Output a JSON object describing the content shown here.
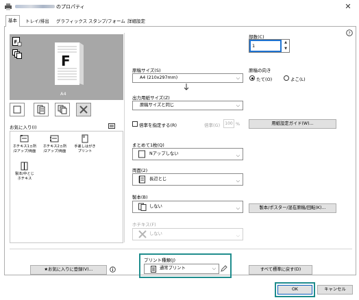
{
  "window": {
    "title": "のプロパティ",
    "close_icon": "close-icon"
  },
  "tabs": [
    {
      "label": "基本",
      "active": true
    },
    {
      "label": "トレイ/排出",
      "active": false
    },
    {
      "label": "グラフィックス",
      "active": false
    },
    {
      "label": "スタンプ/フォーム",
      "active": false
    },
    {
      "label": "詳細設定",
      "active": false
    }
  ],
  "help_icon": "?",
  "preview": {
    "paper_label": "A4",
    "view_buttons": [
      "single-page-view",
      "booklet-view",
      "copies-view",
      "tools-view"
    ]
  },
  "favorites": {
    "label": "お気に入り(I)",
    "items": [
      {
        "label": "ホチキス1ヵ所\n/2アップ/両面"
      },
      {
        "label": "ホチキス2ヵ所\n/2アップ/両面"
      },
      {
        "label": "手差しはがき\nプリント"
      },
      {
        "label": "製本/中とじ\nホチキス"
      }
    ],
    "add_button": "お気に入りに登録(V)..."
  },
  "copies": {
    "label": "部数(C)",
    "value": "1"
  },
  "original_size": {
    "label": "原稿サイズ(S)",
    "value": "A4 (210x297mm)"
  },
  "orientation": {
    "label": "原稿の向き",
    "options": [
      {
        "label": "たて(O)",
        "selected": true
      },
      {
        "label": "よこ(L)",
        "selected": false
      }
    ]
  },
  "output_size": {
    "label": "出力用紙サイズ(Z)",
    "value": "原稿サイズと同じ"
  },
  "scale": {
    "checkbox_label": "倍率を指定する(R)",
    "rate_label": "倍率(G)",
    "rate_value": "100",
    "rate_unit": "%",
    "guide_button": "用紙設定ガイド(W)..."
  },
  "nup": {
    "label": "まとめて1枚(Q)",
    "value": "Nアップしない"
  },
  "duplex": {
    "label": "両面(2)",
    "value": "長辺とじ"
  },
  "booklet": {
    "label": "製本(B)",
    "value": "しない",
    "button": "製本/ポスター/混在原稿/回転(K)..."
  },
  "staple": {
    "label": "ホチキス(F)",
    "value": "しない"
  },
  "print_type": {
    "label": "プリント種類(J)",
    "value": "通常プリント"
  },
  "restore_button": "すべて標準に戻す(D)",
  "ok_button": "OK",
  "cancel_button": "キャンセル",
  "colors": {
    "highlight": "#1e8c8c",
    "focus": "#1e73d2",
    "preview_bg": "#a7a7a7"
  }
}
